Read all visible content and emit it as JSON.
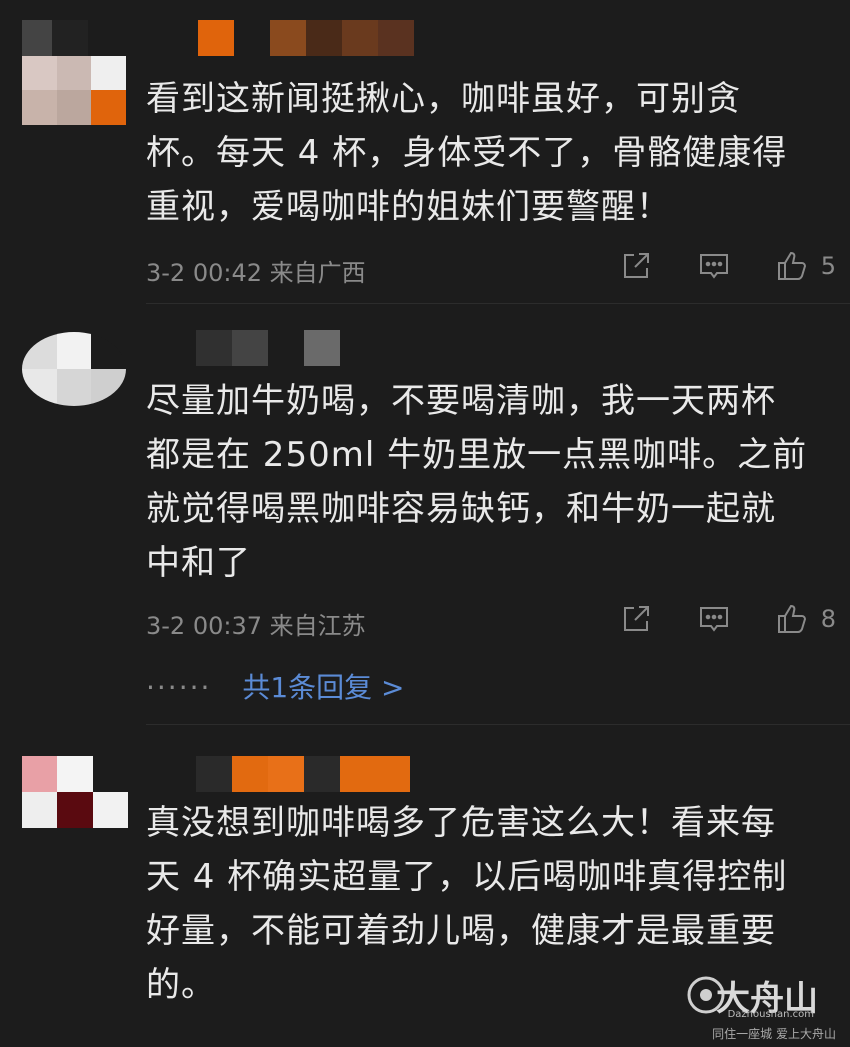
{
  "comments": [
    {
      "text": "看到这新闻挺揪心，咖啡虽好，可别贪\n杯。每天 4 杯，身体受不了，骨骼健康得\n重视，爱喝咖啡的姐妹们要警醒！",
      "time": "3-2 00:42",
      "location": "来自广西",
      "likes": "5"
    },
    {
      "text": "尽量加牛奶喝，不要喝清咖，我一天两杯\n都是在 250ml 牛奶里放一点黑咖啡。之前\n就觉得喝黑咖啡容易缺钙，和牛奶一起就\n中和了",
      "time": "3-2 00:37",
      "location": "来自江苏",
      "likes": "8",
      "reply_dots": "······",
      "reply_link": "共1条回复 >"
    },
    {
      "text": "真没想到咖啡喝多了危害这么大！看来每\n天 4 杯确实超量了，以后喝咖啡真得控制\n好量，不能可着劲儿喝，健康才是最重要\n的。"
    }
  ],
  "icons": [
    "share-icon",
    "comment-icon",
    "like-icon"
  ],
  "watermark": {
    "title": "大舟山",
    "subtitle": "Dazhoushan.com",
    "slogan": "同住一座城 爱上大舟山"
  },
  "colors": {
    "background": "#1c1c1c",
    "text": "#e9e9e9",
    "meta": "#8a8a8a",
    "link": "#5b8bd6",
    "accent_orange": "#e26a10"
  }
}
